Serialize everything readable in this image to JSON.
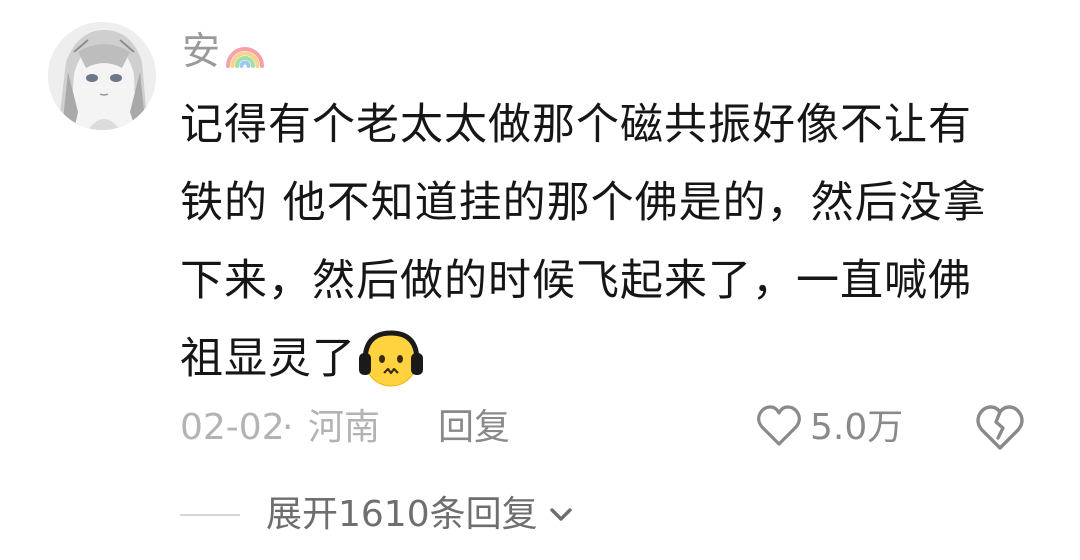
{
  "comment": {
    "username": "安",
    "username_badge_icon": "rainbow-icon",
    "content_lines": [
      "记得有个老太太做那个磁共振好像不让有",
      "铁的 他不知道挂的那个佛是的，然后没拿",
      "下来，然后做的时候飞起来了，一直喊佛",
      "祖显灵了"
    ],
    "trailing_emoji": "headphones-face-emoji",
    "date": "02-02",
    "separator": "·",
    "location": "河南",
    "reply_label": "回复",
    "like_icon": "heart-outline-icon",
    "like_count": "5.0万",
    "dislike_icon": "broken-heart-icon",
    "expand_replies_label": "展开1610条回复",
    "expand_icon": "chevron-down-icon"
  },
  "colors": {
    "text_primary": "#161616",
    "text_secondary": "#9a9a9a",
    "text_muted": "#b3b3b3",
    "background": "#ffffff"
  }
}
